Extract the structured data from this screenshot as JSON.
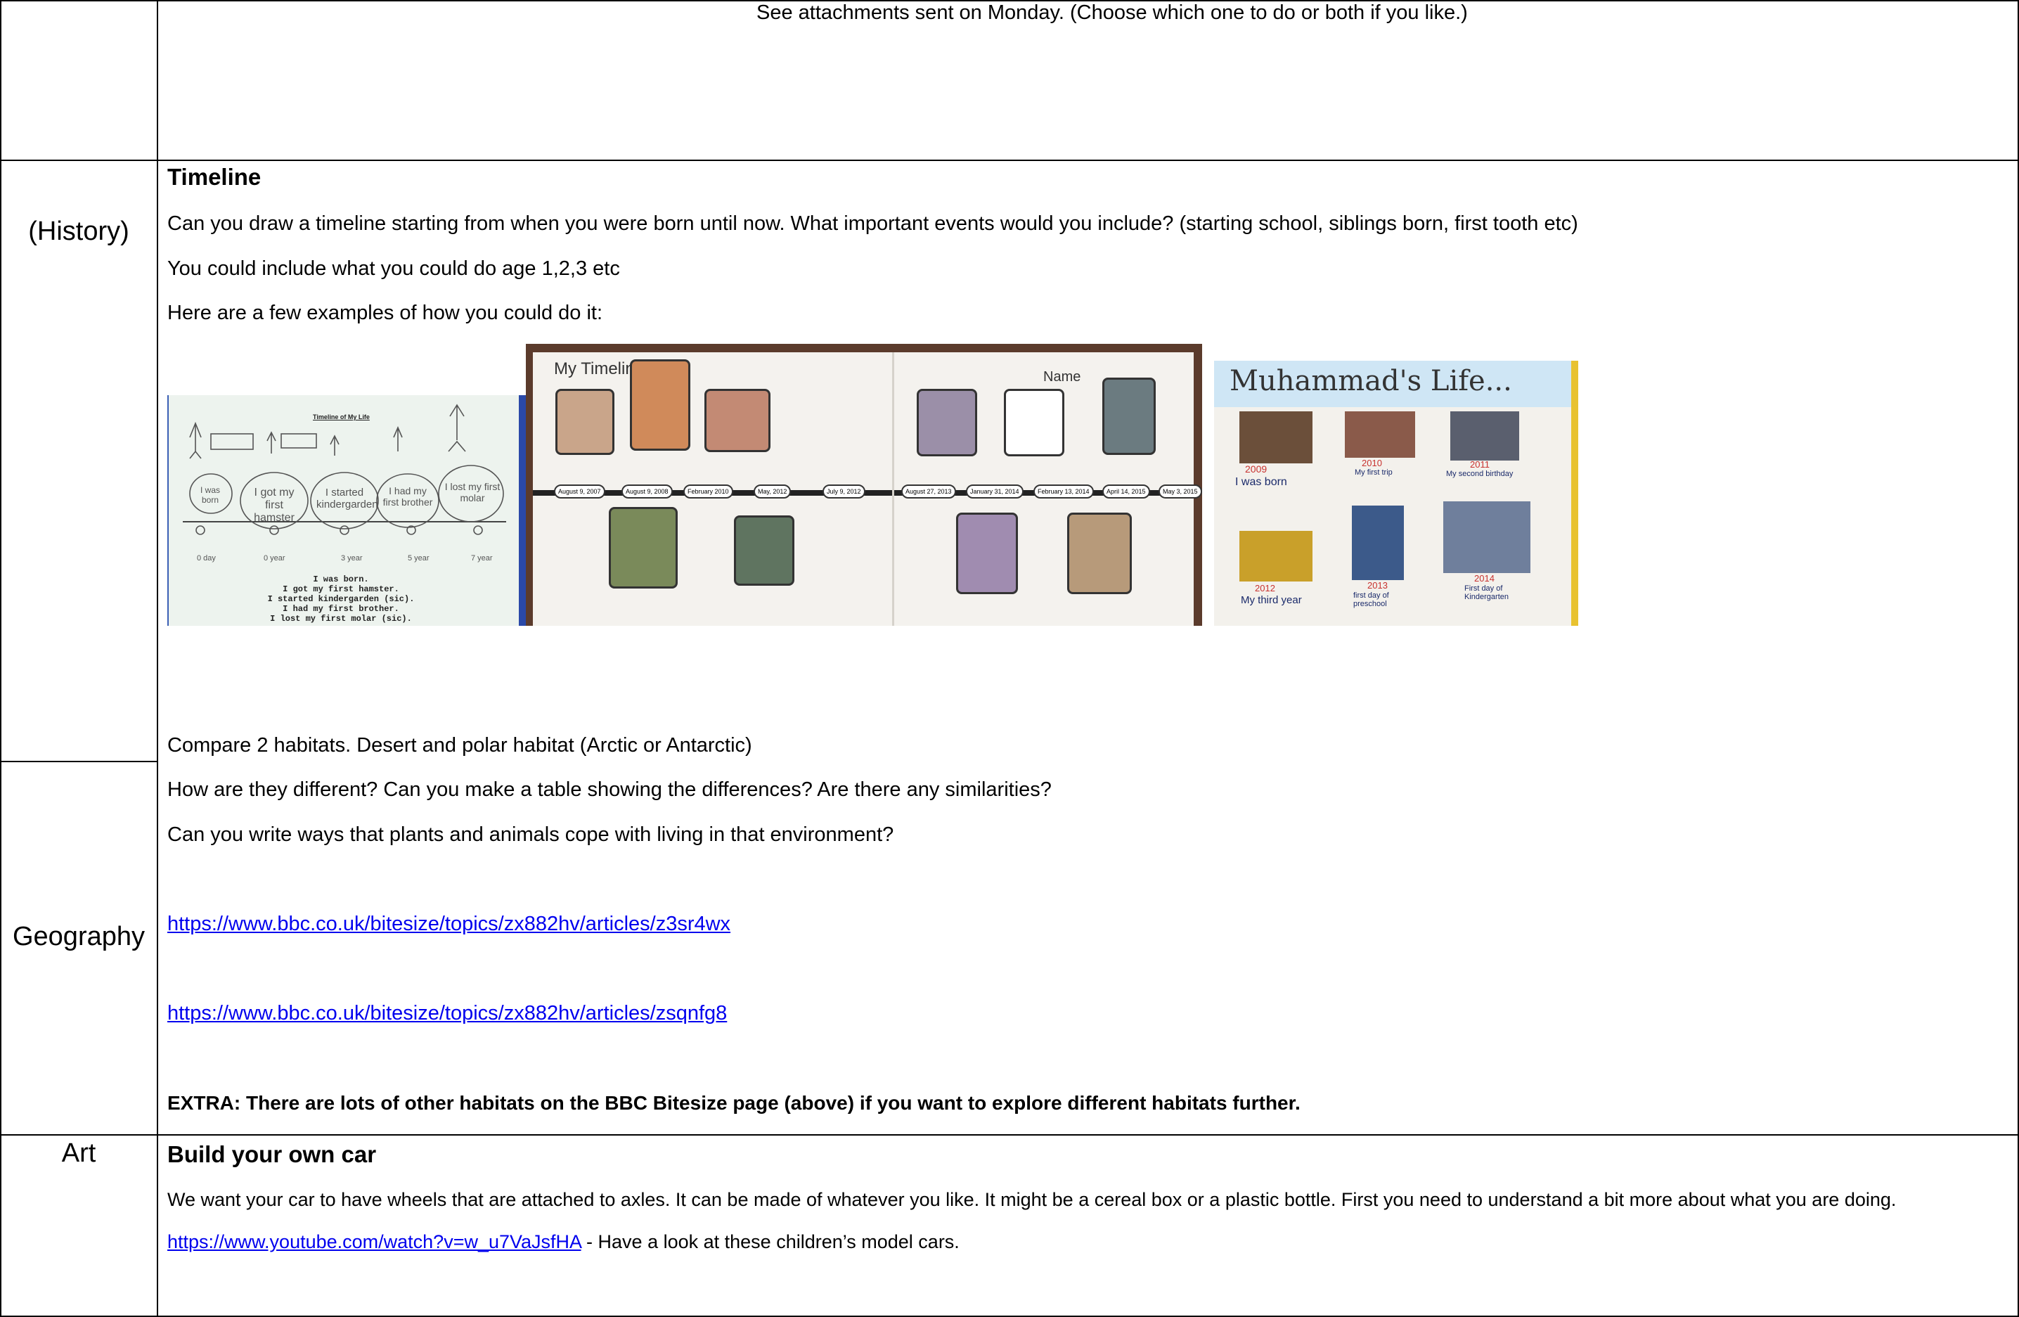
{
  "top_row": {
    "note": "See attachments sent on Monday. (Choose which one to do or both if you like.)"
  },
  "history": {
    "label": "(History)",
    "heading": "Timeline",
    "line1": "Can you draw a timeline starting from when you were born until now. What important events would you include? (starting school, siblings born, first tooth etc)",
    "line2": "You could include what you could do age 1,2,3 etc",
    "line3": "Here are a few examples of how you could do it:",
    "example1": {
      "title": "Timeline of My Life",
      "bubbles": [
        "I was born",
        "I got my first hamster",
        "I started kindergarden",
        "I had my first brother",
        "I lost my first molar"
      ],
      "ages": [
        "0 day",
        "0 year",
        "3 year",
        "5 year",
        "7 year"
      ],
      "caption": [
        "I was born.",
        "I got my first hamster.",
        "I started kindergarden (sic).",
        "I had my first brother.",
        "I lost my first molar (sic)."
      ]
    },
    "example2": {
      "title": "My Timeline",
      "name_label": "Name",
      "dates": [
        "August 9, 2007",
        "August 9, 2008",
        "February 2010",
        "May, 2012",
        "July 9, 2012",
        "August 27, 2013",
        "January 31, 2014",
        "February 13, 2014",
        "April 14, 2015",
        "May 3, 2015"
      ]
    },
    "example3": {
      "title": "Muhammad's Life...",
      "items": [
        {
          "year": "2009",
          "caption": "I was born"
        },
        {
          "year": "2010",
          "caption": "My first trip"
        },
        {
          "year": "2011",
          "caption": "My second birthday"
        },
        {
          "year": "2012",
          "caption": "My third year"
        },
        {
          "year": "2013",
          "caption": "first day of preschool"
        },
        {
          "year": "2014",
          "caption": "First day of Kindergarten"
        }
      ]
    }
  },
  "geography": {
    "label": "Geography",
    "line1": "Compare 2 habitats. Desert and polar habitat (Arctic or Antarctic)",
    "line2": "How are they different? Can you make a table showing the differences?   Are there any similarities?",
    "line3": "Can you write ways that plants and animals cope with living in that environment?",
    "link1": "https://www.bbc.co.uk/bitesize/topics/zx882hv/articles/z3sr4wx",
    "link2": "https://www.bbc.co.uk/bitesize/topics/zx882hv/articles/zsqnfg8",
    "extra": "EXTRA:   There are lots of other habitats on the BBC Bitesize page (above) if you want to explore different habitats further."
  },
  "art": {
    "label": "Art",
    "heading": "Build your own car",
    "line1": "We want your car to have wheels that are attached to axles. It can be made of whatever you like. It might be a cereal box or a plastic bottle. First you need to understand a bit more about what you are doing.",
    "link": "https://www.youtube.com/watch?v=w_u7VaJsfHA",
    "link_suffix": " - Have a look at these children’s model cars."
  },
  "colors": {
    "link": "#0000ee",
    "border": "#000000"
  }
}
